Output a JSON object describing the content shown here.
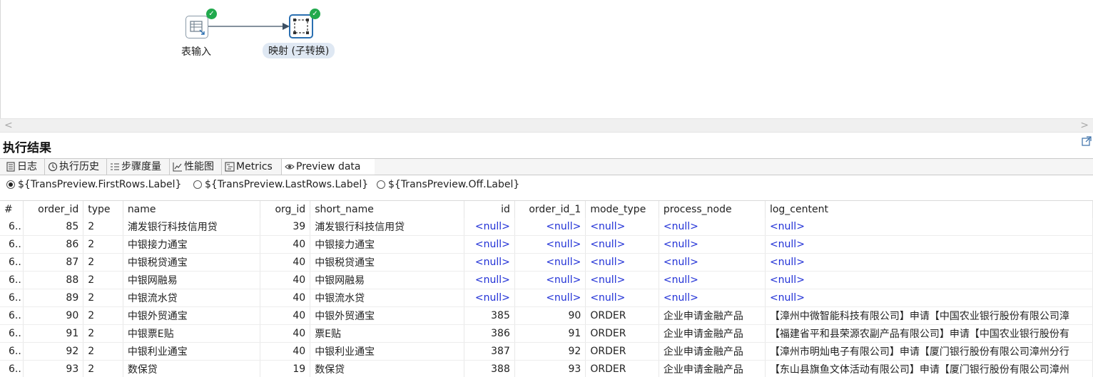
{
  "canvas": {
    "nodes": [
      {
        "label": "表输入",
        "icon": "table-input-icon",
        "status": "success"
      },
      {
        "label": "映射 (子转换)",
        "icon": "mapping-icon",
        "status": "success"
      }
    ]
  },
  "results": {
    "title": "执行结果",
    "tabs": [
      {
        "label": "日志",
        "icon": "log-icon"
      },
      {
        "label": "执行历史",
        "icon": "history-icon"
      },
      {
        "label": "步骤度量",
        "icon": "step-metrics-icon"
      },
      {
        "label": "性能图",
        "icon": "performance-chart-icon"
      },
      {
        "label": "Metrics",
        "icon": "metrics-icon"
      },
      {
        "label": "Preview data",
        "icon": "eye-icon",
        "active": true
      }
    ],
    "radios": [
      {
        "label": "${TransPreview.FirstRows.Label}",
        "checked": true
      },
      {
        "label": "${TransPreview.LastRows.Label}",
        "checked": false
      },
      {
        "label": "${TransPreview.Off.Label}",
        "checked": false
      }
    ]
  },
  "table": {
    "columns": [
      "#",
      "order_id",
      "type",
      "name",
      "org_id",
      "short_name",
      "id",
      "order_id_1",
      "mode_type",
      "process_node",
      "log_centent"
    ],
    "rows": [
      [
        "6..",
        "85",
        "2",
        "浦发银行科技信用贷",
        "39",
        "浦发银行科技信用贷",
        "<null>",
        "<null>",
        "<null>",
        "<null>",
        "<null>"
      ],
      [
        "6..",
        "86",
        "2",
        "中银接力通宝",
        "40",
        "中银接力通宝",
        "<null>",
        "<null>",
        "<null>",
        "<null>",
        "<null>"
      ],
      [
        "6..",
        "87",
        "2",
        "中银税贷通宝",
        "40",
        "中银税贷通宝",
        "<null>",
        "<null>",
        "<null>",
        "<null>",
        "<null>"
      ],
      [
        "6..",
        "88",
        "2",
        "中银网融易",
        "40",
        "中银网融易",
        "<null>",
        "<null>",
        "<null>",
        "<null>",
        "<null>"
      ],
      [
        "6..",
        "89",
        "2",
        "中银流水贷",
        "40",
        "中银流水贷",
        "<null>",
        "<null>",
        "<null>",
        "<null>",
        "<null>"
      ],
      [
        "6..",
        "90",
        "2",
        "中银外贸通宝",
        "40",
        "中银外贸通宝",
        "385",
        "90",
        "ORDER",
        "企业申请金融产品",
        "【漳州中微智能科技有限公司】申请【中国农业银行股份有限公司漳"
      ],
      [
        "6..",
        "91",
        "2",
        "中银票E贴",
        "40",
        "票E贴",
        "386",
        "91",
        "ORDER",
        "企业申请金融产品",
        "【福建省平和县荣源农副产品有限公司】申请【中国农业银行股份有"
      ],
      [
        "6..",
        "92",
        "2",
        "中银利业通宝",
        "40",
        "中银利业通宝",
        "387",
        "92",
        "ORDER",
        "企业申请金融产品",
        "【漳州市明灿电子有限公司】申请【厦门银行股份有限公司漳州分行"
      ],
      [
        "6..",
        "93",
        "2",
        "数保贷",
        "19",
        "数保贷",
        "388",
        "93",
        "ORDER",
        "企业申请金融产品",
        "【东山县旗鱼文体活动有限公司】申请【厦门银行股份有限公司漳州"
      ]
    ]
  }
}
